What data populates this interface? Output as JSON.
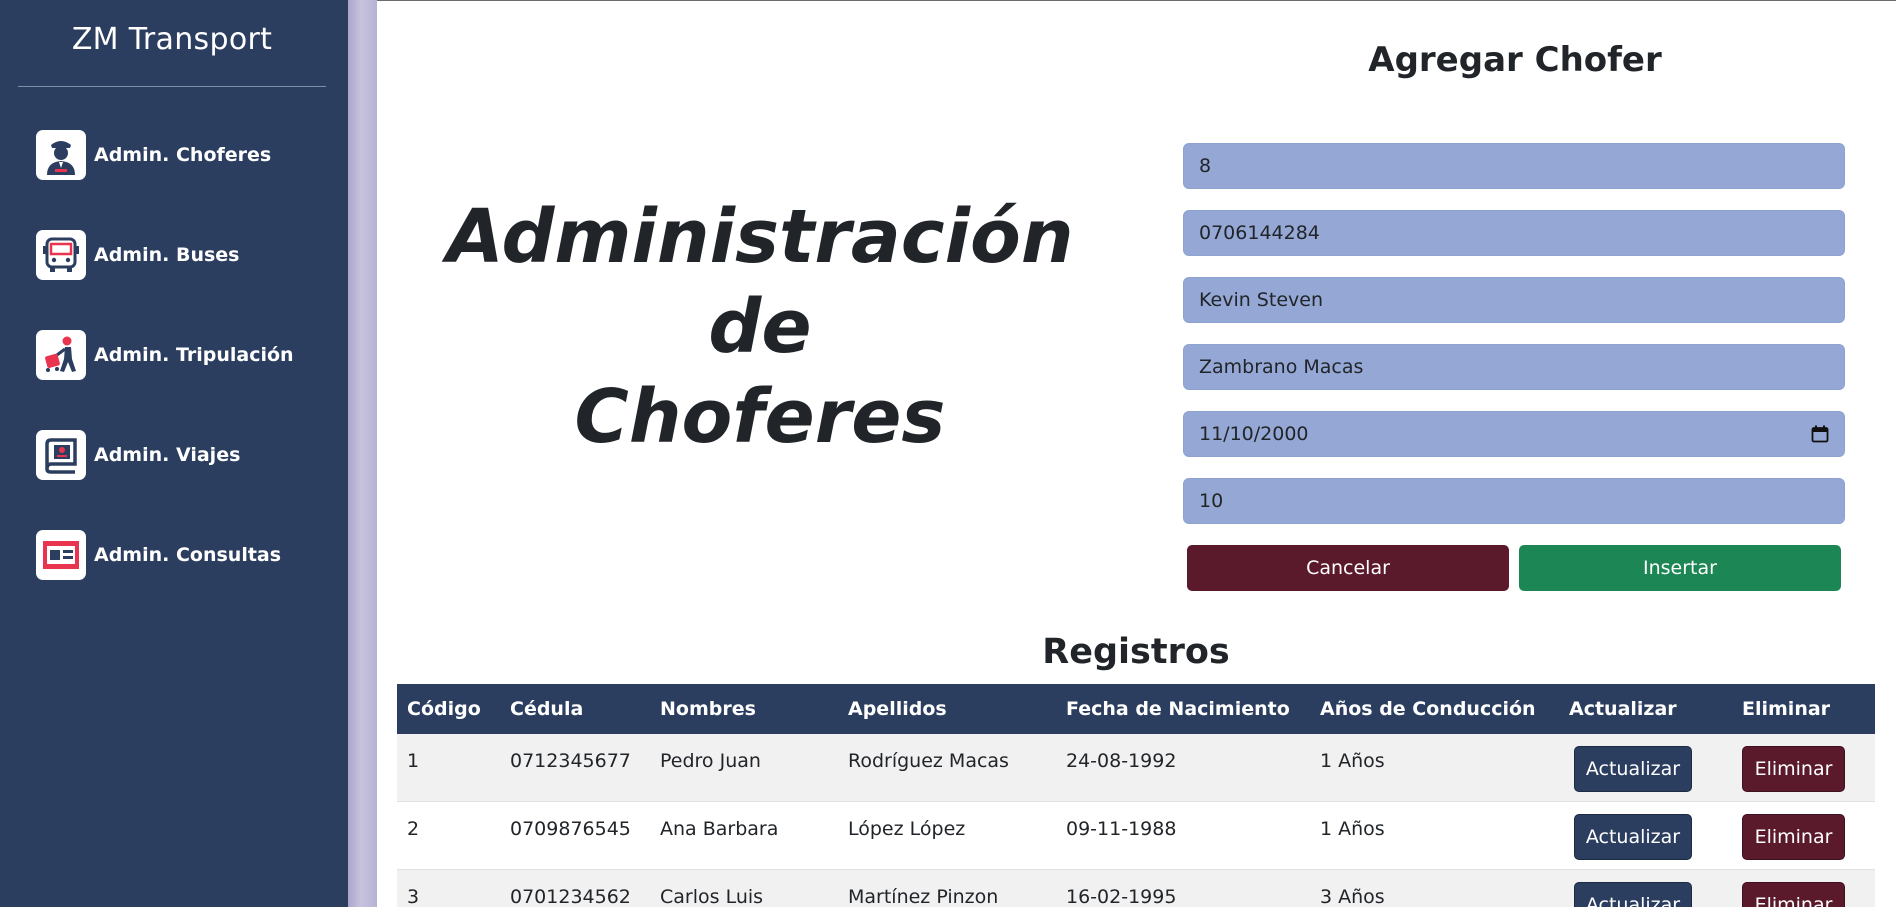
{
  "app": {
    "brand": "ZM Transport"
  },
  "sidebar": {
    "items": [
      {
        "label": "Admin. Choferes",
        "icon": "driver-icon"
      },
      {
        "label": "Admin. Buses",
        "icon": "bus-icon"
      },
      {
        "label": "Admin. Tripulación",
        "icon": "crew-icon"
      },
      {
        "label": "Admin. Viajes",
        "icon": "trips-icon"
      },
      {
        "label": "Admin. Consultas",
        "icon": "queries-icon"
      }
    ]
  },
  "main": {
    "title_lines": [
      "Administración",
      "de",
      "Choferes"
    ]
  },
  "form": {
    "title": "Agregar Chofer",
    "fields": {
      "codigo": "8",
      "cedula": "0706144284",
      "nombres": "Kevin Steven",
      "apellidos": "Zambrano Macas",
      "fecha": "11/10/2000",
      "anios": "10"
    },
    "cancel_label": "Cancelar",
    "insert_label": "Insertar"
  },
  "records": {
    "title": "Registros",
    "columns": [
      "Código",
      "Cédula",
      "Nombres",
      "Apellidos",
      "Fecha de Nacimiento",
      "Años de Conducción",
      "Actualizar",
      "Eliminar"
    ],
    "rows": [
      {
        "codigo": "1",
        "cedula": "0712345677",
        "nombres": "Pedro Juan",
        "apellidos": "Rodríguez Macas",
        "fecha": "24-08-1992",
        "anios": "1 Años"
      },
      {
        "codigo": "2",
        "cedula": "0709876545",
        "nombres": "Ana Barbara",
        "apellidos": "López López",
        "fecha": "09-11-1988",
        "anios": "1 Años"
      },
      {
        "codigo": "3",
        "cedula": "0701234562",
        "nombres": "Carlos Luis",
        "apellidos": "Martínez Pinzon",
        "fecha": "16-02-1995",
        "anios": "3 Años"
      }
    ],
    "update_label": "Actualizar",
    "delete_label": "Eliminar"
  },
  "colors": {
    "sidebar": "#2c3e5f",
    "input_bg": "#95a8d5",
    "cancel": "#5a1a2c",
    "insert": "#1c8654"
  }
}
